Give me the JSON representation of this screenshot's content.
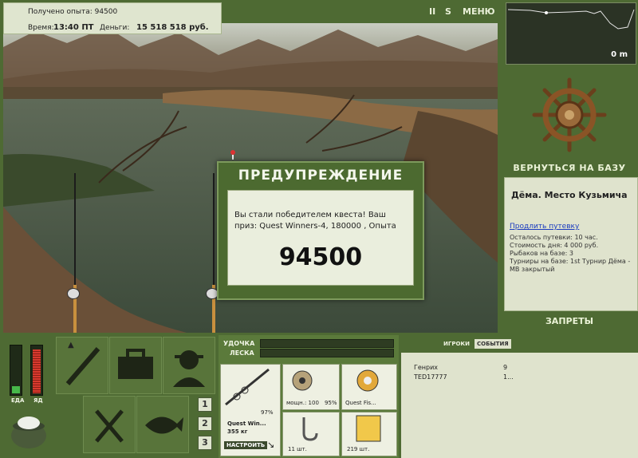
{
  "info": {
    "exp_line": "Получено опыта: 94500",
    "time_label": "Время:",
    "time_value": "13:40 ПТ",
    "money_label": "Деньги:",
    "money_value": "15 518 518 руб."
  },
  "toolbar": {
    "pause": "II",
    "s": "S",
    "menu": "МЕНЮ"
  },
  "minimap": {
    "depth": "0 m"
  },
  "right": {
    "return_label": "ВЕРНУТЬСЯ НА БАЗУ",
    "location_title": "Дёма. Место Кузьмича",
    "extend_link": "Продлить путевку",
    "lines": [
      "Осталось путевки: 10 час.",
      "Стоимость дня: 4 000 руб.",
      "Рыбаков на базе: 3",
      "Турниры на базе: 1st Турнир Дёма - МВ закрытый"
    ],
    "bans_label": "ЗАПРЕТЫ"
  },
  "dialog": {
    "title": "ПРЕДУПРЕЖДЕНИЕ",
    "message": "Вы стали победителем квеста! Ваш приз: Quest Winners-4, 180000 , Опыта",
    "number": "94500"
  },
  "meters": {
    "food_label": "ЕДА",
    "poison_label": "ЯД",
    "food_level": 0.15,
    "poison_level": 0.95
  },
  "pages": [
    "1",
    "2",
    "3"
  ],
  "tackle": {
    "rod_label": "УДОЧКА",
    "line_label": "ЛЕСКА",
    "rod_pct": "97%",
    "rod_name": "Quest Win...",
    "rod_weight": "355 кг",
    "setup_button": "НАСТРОИТЬ",
    "reel_power": "мощн.: 100",
    "reel_pct": "95%",
    "line_name": "Quest Fis...",
    "hook_count": "11 шт.",
    "bait_count": "219 шт."
  },
  "players": {
    "tab_players": "ИГРОКИ",
    "tab_events": "СОБЫТИЯ",
    "rows": [
      {
        "name": "Генрих",
        "value": "9"
      },
      {
        "name": "TED17777",
        "value": "1..."
      }
    ]
  },
  "colors": {
    "panel": "#4e6a33",
    "light": "#dfe3cd",
    "accent": "#c43a2e"
  }
}
